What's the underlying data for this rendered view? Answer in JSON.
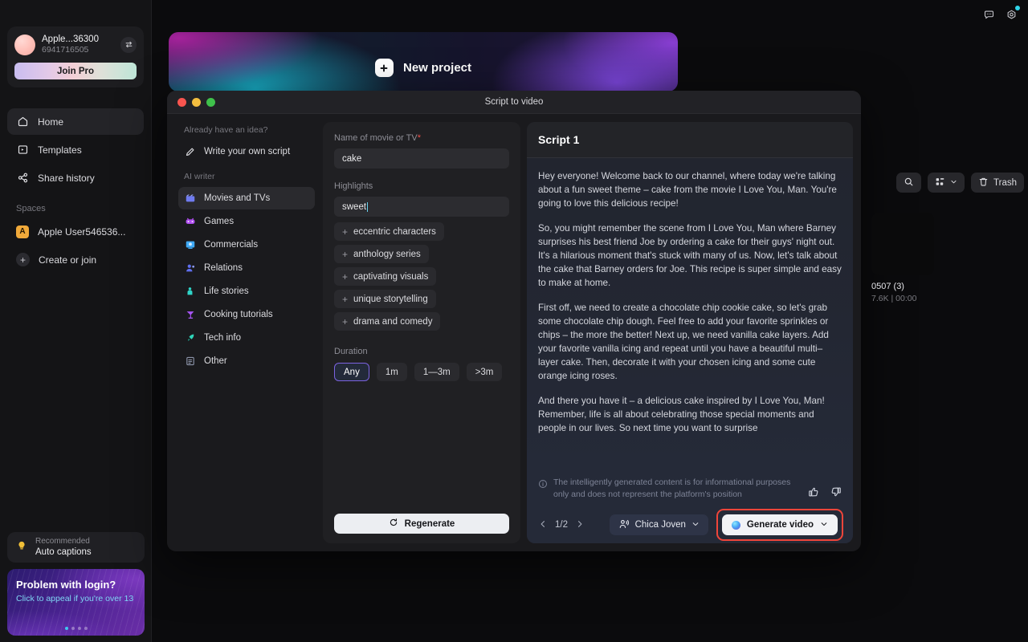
{
  "sidebar": {
    "profile": {
      "name": "Apple...36300",
      "id": "6941716505",
      "swap_icon": "swap-arrows-icon",
      "join_pro_label": "Join Pro"
    },
    "nav": [
      {
        "label": "Home",
        "icon": "home-icon",
        "active": true
      },
      {
        "label": "Templates",
        "icon": "templates-icon",
        "active": false
      },
      {
        "label": "Share history",
        "icon": "share-icon",
        "active": false
      }
    ],
    "spaces_label": "Spaces",
    "spaces": [
      {
        "label": "Apple User546536...",
        "badge": "A"
      },
      {
        "label": "Create or join",
        "icon": "plus-icon"
      }
    ],
    "promo_recommended": {
      "kicker": "Recommended",
      "title": "Auto captions",
      "icon": "lightbulb-icon"
    },
    "promo_login": {
      "title": "Problem with login?",
      "subtitle": "Click to appeal if you're over 13",
      "dots": 4,
      "active_dot": 0
    }
  },
  "topbar": {
    "feedback_icon": "chat-bubble-icon",
    "settings_icon": "gear-icon",
    "has_notification": true,
    "notification_color": "#2fd4e8"
  },
  "banner": {
    "title": "New project",
    "icon": "plus-square-icon"
  },
  "modal": {
    "title": "Script to video",
    "window_controls": [
      "close",
      "minimize",
      "maximize"
    ],
    "idea_section_label": "Already have an idea?",
    "write_own_script": {
      "label": "Write your own script",
      "icon": "pencil-icon"
    },
    "ai_writer_label": "AI writer",
    "categories": [
      {
        "label": "Movies and TVs",
        "icon": "clapperboard-icon",
        "color": "#6f7bf0",
        "active": true
      },
      {
        "label": "Games",
        "icon": "gamepad-icon",
        "color": "#b04ff0",
        "active": false
      },
      {
        "label": "Commercials",
        "icon": "monitor-icon",
        "color": "#3fa9f5",
        "active": false
      },
      {
        "label": "Relations",
        "icon": "people-icon",
        "color": "#5f6ff0",
        "active": false
      },
      {
        "label": "Life stories",
        "icon": "person-icon",
        "color": "#2fd4c8",
        "active": false
      },
      {
        "label": "Cooking tutorials",
        "icon": "cocktail-icon",
        "color": "#a855f7",
        "active": false
      },
      {
        "label": "Tech info",
        "icon": "rocket-icon",
        "color": "#2fd4b8",
        "active": false
      },
      {
        "label": "Other",
        "icon": "document-icon",
        "color": "#8b93a8",
        "active": false
      }
    ],
    "form": {
      "name_label": "Name of movie or TV",
      "name_required_mark": "*",
      "name_value": "cake",
      "highlights_label": "Highlights",
      "highlights_value": "sweet",
      "suggestions": [
        "eccentric characters",
        "anthology series",
        "captivating visuals",
        "unique storytelling",
        "drama and comedy"
      ],
      "duration_label": "Duration",
      "durations": [
        {
          "label": "Any",
          "selected": true
        },
        {
          "label": "1m",
          "selected": false
        },
        {
          "label": "1—3m",
          "selected": false
        },
        {
          "label": ">3m",
          "selected": false
        }
      ],
      "regenerate_label": "Regenerate",
      "regenerate_icon": "refresh-icon"
    },
    "script": {
      "title": "Script 1",
      "paragraphs": [
        "Hey everyone! Welcome back to our channel, where today we're talking about a fun sweet theme – cake from the movie I Love You, Man. You're going to love this delicious recipe!",
        "So, you might remember the scene from I Love You, Man where Barney surprises his best friend Joe by ordering a cake for their guys' night out. It's a hilarious moment that's stuck with many of us. Now, let's talk about the cake that Barney orders for Joe. This recipe is super simple and easy to make at home.",
        "First off, we need to create a chocolate chip cookie cake, so let's grab some chocolate chip dough. Feel free to add your favorite sprinkles or chips – the more the better! Next up, we need vanilla cake layers. Add your favorite vanilla icing and repeat until you have a beautiful multi–layer cake. Then, decorate it with your chosen icing and some cute orange icing roses.",
        "And there you have it – a delicious cake inspired by I Love You, Man! Remember, life is all about celebrating those special moments and people in our lives. So next time you want to surprise"
      ],
      "disclaimer": "The intelligently generated content is for informational purposes only and does not represent the platform's position",
      "disclaimer_icon": "info-icon",
      "thumbs_up_icon": "thumbs-up-icon",
      "thumbs_down_icon": "thumbs-down-icon",
      "pagination": "1/2",
      "prev_icon": "chevron-left-icon",
      "next_icon": "chevron-right-icon",
      "voice": {
        "label": "Chica Joven",
        "icon": "voice-icon",
        "chevron": "chevron-down-icon"
      },
      "generate": {
        "label": "Generate video",
        "icon": "ai-orb-icon",
        "chevron": "chevron-down-icon",
        "highlight_color": "#f0453a"
      }
    }
  },
  "right_panel": {
    "search_icon": "search-icon",
    "view_icon": "grid-view-icon",
    "view_chevron": "chevron-down-icon",
    "trash_label": "Trash",
    "trash_icon": "trash-icon",
    "items": [
      {
        "name": "0507 (3)",
        "meta": "7.6K | 00:00"
      }
    ]
  }
}
